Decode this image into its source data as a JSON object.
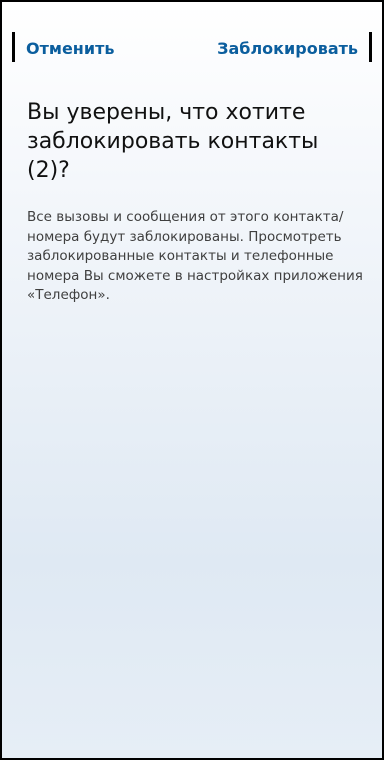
{
  "header": {
    "cancel_label": "Отменить",
    "block_label": "Заблокировать"
  },
  "dialog": {
    "title": "Вы уверены, что хотите заблокировать контакты (2)?",
    "message": "Все вызовы и сообщения от этого контакта/номера будут заблокированы. Просмотреть заблокированные контакты и телефонные номера Вы сможете в настройках приложения «Телефон»."
  },
  "colors": {
    "accent": "#0b5e9e",
    "title_text": "#111111",
    "body_text": "#3f3f3f"
  }
}
